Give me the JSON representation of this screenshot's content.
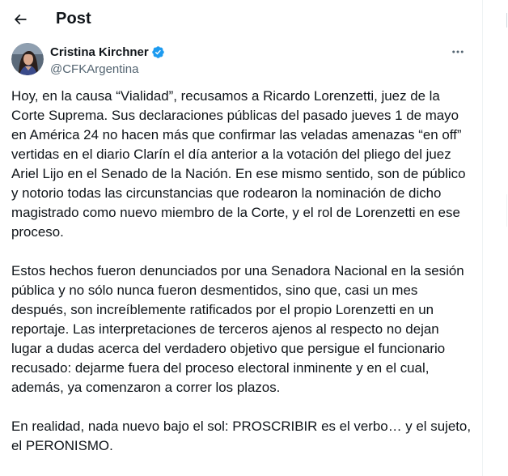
{
  "header": {
    "title": "Post",
    "back_icon": "arrow-left-icon"
  },
  "author": {
    "display_name": "Cristina Kirchner",
    "handle": "@CFKArgentina",
    "verified_icon": "verified-badge-icon",
    "verified_color": "#1d9bf0",
    "more_icon": "more-horizontal-icon"
  },
  "post": {
    "paragraphs": [
      "Hoy, en la causa “Vialidad”, recusamos a Ricardo Lorenzetti, juez de la Corte Suprema. Sus declaraciones públicas del pasado jueves 1 de mayo en América 24 no hacen más que confirmar las veladas amenazas “en off” vertidas en el diario Clarín el día anterior a la votación del pliego del juez Ariel Lijo en el Senado de la Nación. En ese mismo sentido, son de público y notorio todas las circunstancias que rodearon la nominación de dicho magistrado como nuevo miembro de la Corte, y el rol de Lorenzetti en ese proceso.",
      "Estos hechos fueron denunciados por una Senadora Nacional en la sesión pública y no sólo nunca fueron desmentidos, sino que, casi un mes después, son increíblemente ratificados por el propio Lorenzetti en un reportaje. Las interpretaciones de terceros ajenos al respecto no dejan lugar a dudas acerca del verdadero objetivo que persigue el funcionario recusado: dejarme fuera del proceso electoral inminente y en el cual, además, ya comenzaron a correr los plazos.",
      "En realidad, nada nuevo bajo el sol: PROSCRIBIR es el verbo… y el sujeto, el PERONISMO."
    ]
  },
  "colors": {
    "text_primary": "#0f1419",
    "text_secondary": "#536471",
    "accent": "#1d9bf0",
    "border": "#eff3f4"
  }
}
